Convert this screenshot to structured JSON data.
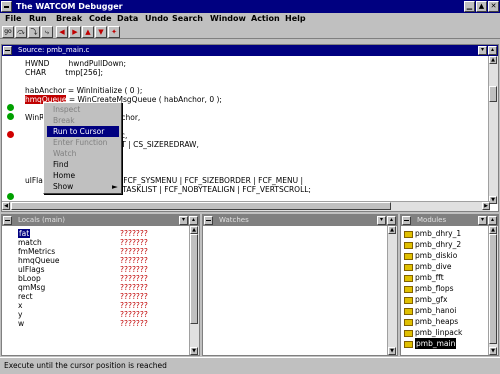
{
  "window": {
    "title": "The WATCOM Debugger"
  },
  "menu": [
    "File",
    "Run",
    "Break",
    "Code",
    "Data",
    "Undo",
    "Search",
    "Window",
    "Action",
    "Help"
  ],
  "toolbar": {
    "buttons": [
      "go",
      "step-over",
      "trace",
      "step-into",
      "left",
      "right",
      "up",
      "down",
      "home"
    ],
    "first_label": "go"
  },
  "source": {
    "title": "Source: pmb_main.c",
    "lines": [
      "HWND        hwndPullDown;",
      "CHAR        tmp[256];",
      "",
      "habAnchor = WinInitialize ( 0 );",
      "hmqQueue = WinCreateMsgQueue ( habAnchor, 0 );",
      "",
      "WinRegisterClass ( habAnchor,",
      "                   CLIENT,",
      "                   ClientWndProc,",
      "                   CS_SYNCPAINT | CS_SIZEREDRAW,",
      "",
      "",
      "ulFlags = FCF_TITLEBAR | FCF_SYSMENU | FCF_SIZEBORDER | FCF_MENU |",
      "          FCF_MINMAX | FCF_TASKLIST | FCF_NOBYTEALIGN | FCF_VERTSCROLL;"
    ],
    "highlight": "hmqQueue"
  },
  "context_menu": {
    "items": [
      {
        "label": "Inspect",
        "enabled": false
      },
      {
        "label": "Break",
        "enabled": false
      },
      {
        "label": "Run to Cursor",
        "enabled": true,
        "selected": true
      },
      {
        "label": "Enter Function",
        "enabled": false
      },
      {
        "label": "Watch",
        "enabled": false
      },
      {
        "label": "Find",
        "enabled": true
      },
      {
        "label": "Home",
        "enabled": true
      },
      {
        "label": "Show",
        "enabled": true,
        "submenu": true
      }
    ],
    "submenu_arrow": "►"
  },
  "locals": {
    "title": "Locals (main)",
    "vars": [
      {
        "name": "fat",
        "value": "???????"
      },
      {
        "name": "match",
        "value": "???????"
      },
      {
        "name": "fmMetrics",
        "value": "???????"
      },
      {
        "name": "hmqQueue",
        "value": "???????"
      },
      {
        "name": "ulFlags",
        "value": "???????"
      },
      {
        "name": "bLoop",
        "value": "???????"
      },
      {
        "name": "qmMsg",
        "value": "???????"
      },
      {
        "name": "rect",
        "value": "???????"
      },
      {
        "name": "x",
        "value": "???????"
      },
      {
        "name": "y",
        "value": "???????"
      },
      {
        "name": "w",
        "value": "???????"
      }
    ]
  },
  "watches": {
    "title": "Watches"
  },
  "modules": {
    "title": "Modules",
    "items": [
      "pmb_dhry_1",
      "pmb_dhry_2",
      "pmb_diskio",
      "pmb_dive",
      "pmb_fft",
      "pmb_flops",
      "pmb_gfx",
      "pmb_hanoi",
      "pmb_heaps",
      "pmb_linpack",
      "pmb_main"
    ],
    "selected": "pmb_main"
  },
  "status": {
    "text": "Execute until the cursor position is reached"
  }
}
